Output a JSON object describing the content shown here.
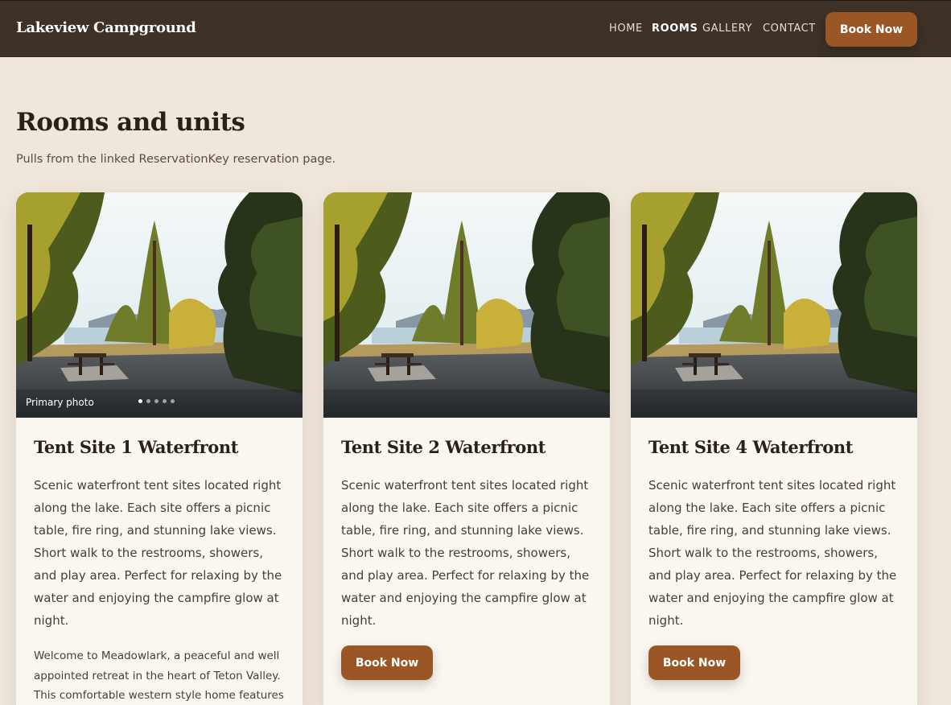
{
  "header": {
    "brand": "Lakeview Campground",
    "nav": [
      "HOME",
      "ROOMS",
      "GALLERY",
      "CONTACT"
    ],
    "active_nav": "ROOMS",
    "book_label": "Book Now"
  },
  "main": {
    "title": "Rooms and units",
    "subtitle": "Pulls from the linked ReservationKey reservation page."
  },
  "cards": [
    {
      "title": "Tent Site 1 Waterfront",
      "description": "Scenic waterfront tent sites located right along the lake. Each site offers a picnic table, fire ring, and stunning lake views. Short walk to the restrooms, showers, and play area. Perfect for relaxing by the water and enjoying the campfire glow at night.",
      "photo_caption": "Primary photo",
      "carousel_dots": 5,
      "extra": "Welcome to Meadowlark, a peaceful and well appointed retreat in the heart of Teton Valley. This comfortable western style home features an"
    },
    {
      "title": "Tent Site 2 Waterfront",
      "description": "Scenic waterfront tent sites located right along the lake. Each site offers a picnic table, fire ring, and stunning lake views. Short walk to the restrooms, showers, and play area. Perfect for relaxing by the water and enjoying the campfire glow at night.",
      "book_label": "Book Now"
    },
    {
      "title": "Tent Site 4 Waterfront",
      "description": "Scenic waterfront tent sites located right along the lake. Each site offers a picnic table, fire ring, and stunning lake views. Short walk to the restrooms, showers, and play area. Perfect for relaxing by the water and enjoying the campfire glow at night.",
      "book_label": "Book Now"
    }
  ],
  "colors": {
    "header_bg": "#3d3128",
    "page_bg": "#efe6dc",
    "card_bg": "#faf6f0",
    "accent": "#9a5624"
  }
}
